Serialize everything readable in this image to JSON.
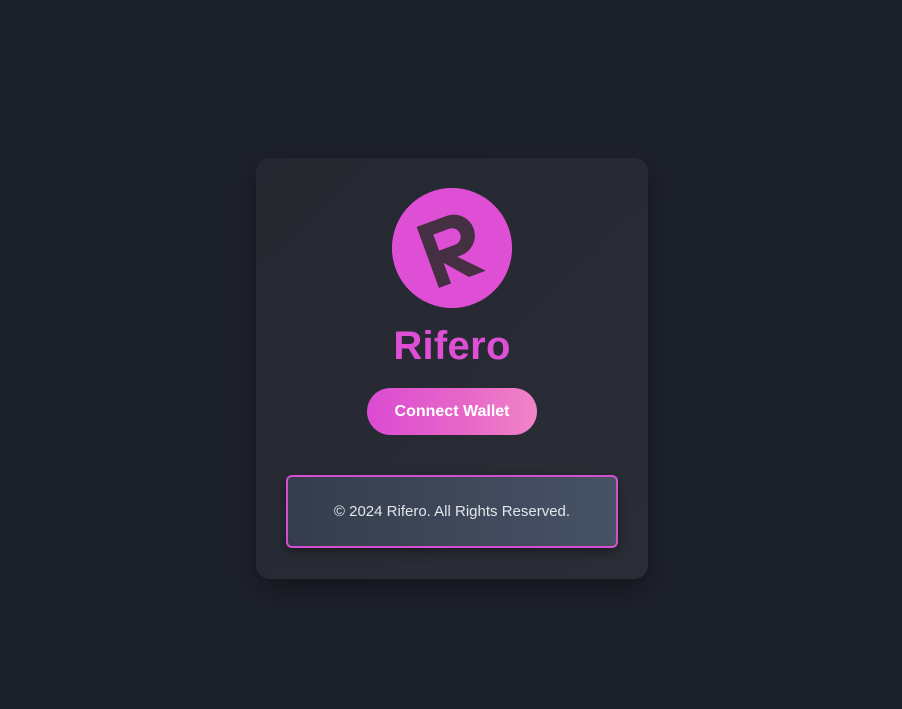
{
  "app": {
    "brand_name": "Rifero",
    "logo_letter": "R",
    "logo_icon": "rifero-logo-icon"
  },
  "actions": {
    "connect_label": "Connect Wallet"
  },
  "footer": {
    "copyright": "© 2024 Rifero. All Rights Reserved."
  },
  "colors": {
    "background": "#1d212b",
    "card": "#282b33",
    "accent": "#de4fd5",
    "accent_light": "#f184c8",
    "footer_border": "#d24fd0",
    "footer_text": "#e2e5ea",
    "logo_letter": "#452f43"
  }
}
